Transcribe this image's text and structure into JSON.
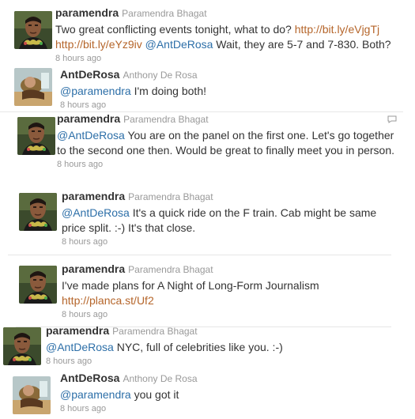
{
  "tweets": [
    {
      "screen_name": "paramendra",
      "full_name": "Paramendra Bhagat",
      "avatar": "paramendra-avatar",
      "segments": [
        {
          "t": "Two great conflicting events tonight, what to do? ",
          "k": "text"
        },
        {
          "t": "http://bit.ly/eVjgTj",
          "k": "url"
        },
        {
          "t": " ",
          "k": "text"
        },
        {
          "t": "http://bit.ly/eYz9iv",
          "k": "url"
        },
        {
          "t": " ",
          "k": "text"
        },
        {
          "t": "@AntDeRosa",
          "k": "mention"
        },
        {
          "t": " Wait, they are 5-7 and 7-830. Both?",
          "k": "text"
        }
      ],
      "time": "8 hours ago"
    },
    {
      "screen_name": "AntDeRosa",
      "full_name": "Anthony De Rosa",
      "avatar": "antderosa-avatar",
      "segments": [
        {
          "t": "@paramendra",
          "k": "mention"
        },
        {
          "t": " I'm doing both!",
          "k": "text"
        }
      ],
      "time": "8 hours ago"
    },
    {
      "screen_name": "paramendra",
      "full_name": "Paramendra Bhagat",
      "avatar": "paramendra-avatar",
      "segments": [
        {
          "t": "@AntDeRosa",
          "k": "mention"
        },
        {
          "t": " You are on the panel on the first one. Let's go together to the second one then. Would be great to finally meet you in person.",
          "k": "text"
        }
      ],
      "time": "8 hours ago"
    },
    {
      "screen_name": "paramendra",
      "full_name": "Paramendra Bhagat",
      "avatar": "paramendra-avatar",
      "segments": [
        {
          "t": "@AntDeRosa",
          "k": "mention"
        },
        {
          "t": " It's a quick ride on the F train. Cab might be same price split. :-) It's that close.",
          "k": "text"
        }
      ],
      "time": "8 hours ago"
    },
    {
      "screen_name": "paramendra",
      "full_name": "Paramendra Bhagat",
      "avatar": "paramendra-avatar",
      "segments": [
        {
          "t": "I've made plans for A Night of Long-Form Journalism ",
          "k": "text"
        },
        {
          "t": "http://planca.st/Uf2",
          "k": "url"
        }
      ],
      "time": "8 hours ago"
    },
    {
      "screen_name": "paramendra",
      "full_name": "Paramendra Bhagat",
      "avatar": "paramendra-avatar",
      "segments": [
        {
          "t": "@AntDeRosa",
          "k": "mention"
        },
        {
          "t": " NYC, full of celebrities like you. :-)",
          "k": "text"
        }
      ],
      "time": "8 hours ago"
    },
    {
      "screen_name": "AntDeRosa",
      "full_name": "Anthony De Rosa",
      "avatar": "antderosa-avatar",
      "segments": [
        {
          "t": "@paramendra",
          "k": "mention"
        },
        {
          "t": " you got it",
          "k": "text"
        }
      ],
      "time": "8 hours ago"
    }
  ],
  "icons": {
    "reply": "reply-icon"
  },
  "colors": {
    "mention": "#2d6fa8",
    "url": "#b5652a",
    "muted": "#999999",
    "text": "#333333"
  }
}
